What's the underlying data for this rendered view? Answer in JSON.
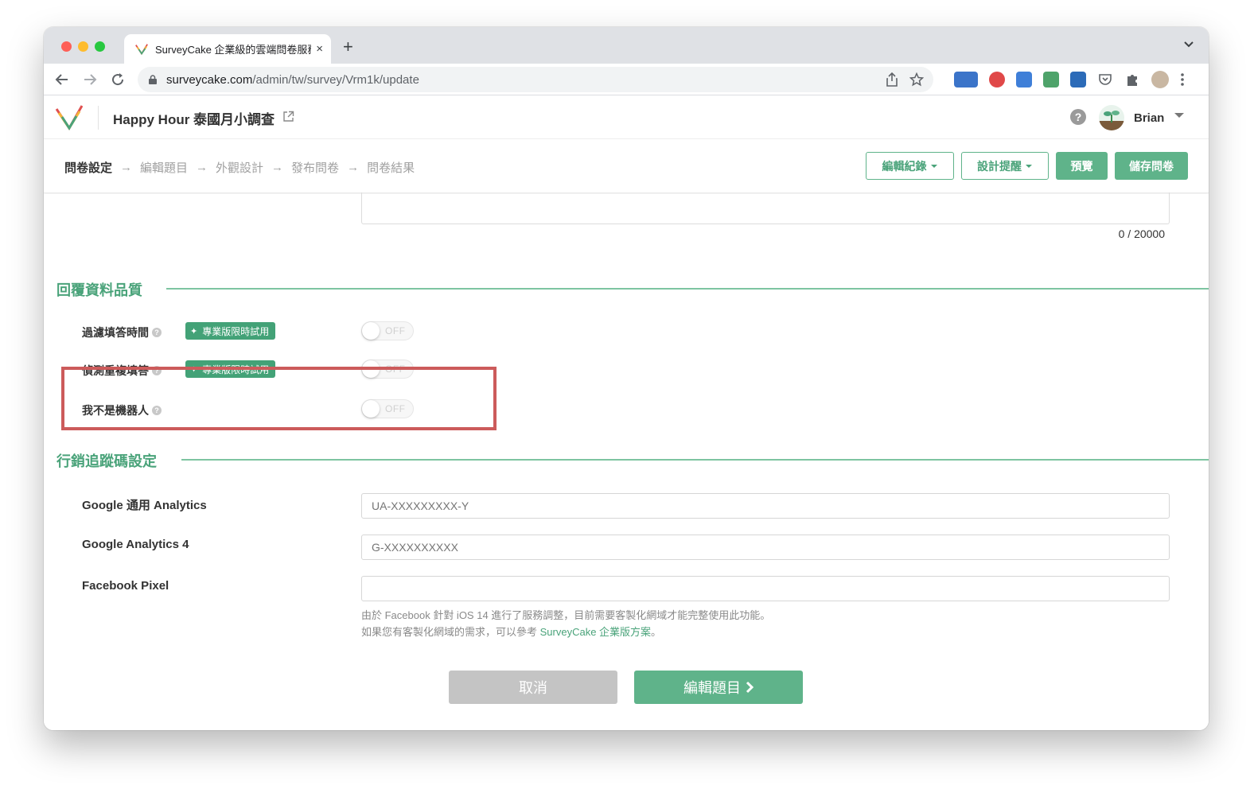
{
  "browser": {
    "tab_title": "SurveyCake 企業級的雲端問卷服務",
    "tab_close": "×",
    "new_tab": "+",
    "url_host": "surveycake.com",
    "url_path": "/admin/tw/survey/Vrm1k/update"
  },
  "header": {
    "survey_title": "Happy Hour 泰國月小調查",
    "help": "?",
    "username": "Brian"
  },
  "steps": [
    {
      "label": "問卷設定"
    },
    {
      "label": "編輯題目"
    },
    {
      "label": "外觀設計"
    },
    {
      "label": "發布問卷"
    },
    {
      "label": "問卷結果"
    }
  ],
  "step_arrow": "→",
  "actions": {
    "edit_log": "編輯紀錄",
    "design_tips": "設計提醒",
    "preview": "預覽",
    "save": "儲存問卷"
  },
  "char_count": "0 / 20000",
  "quality": {
    "title": "回覆資料品質",
    "badge": "專業版限時試用",
    "off": "OFF",
    "rows": [
      {
        "label": "過濾填答時間"
      },
      {
        "label": "偵測重複填答"
      },
      {
        "label": "我不是機器人"
      }
    ]
  },
  "tracking": {
    "title": "行銷追蹤碼設定",
    "fields": [
      {
        "label": "Google 通用 Analytics",
        "placeholder": "UA-XXXXXXXXX-Y"
      },
      {
        "label": "Google Analytics 4",
        "placeholder": "G-XXXXXXXXXX"
      },
      {
        "label": "Facebook Pixel",
        "placeholder": ""
      }
    ],
    "note_line1": "由於 Facebook 針對 iOS 14 進行了服務調整，目前需要客製化網域才能完整使用此功能。",
    "note_line2_prefix": "如果您有客製化網域的需求，可以參考 ",
    "note_link": "SurveyCake 企業版方案",
    "note_line2_suffix": "。"
  },
  "footer": {
    "cancel": "取消",
    "next": "編輯題目"
  },
  "colors": {
    "brand_green": "#5fb38a",
    "highlight_red": "#cc5b5b"
  }
}
